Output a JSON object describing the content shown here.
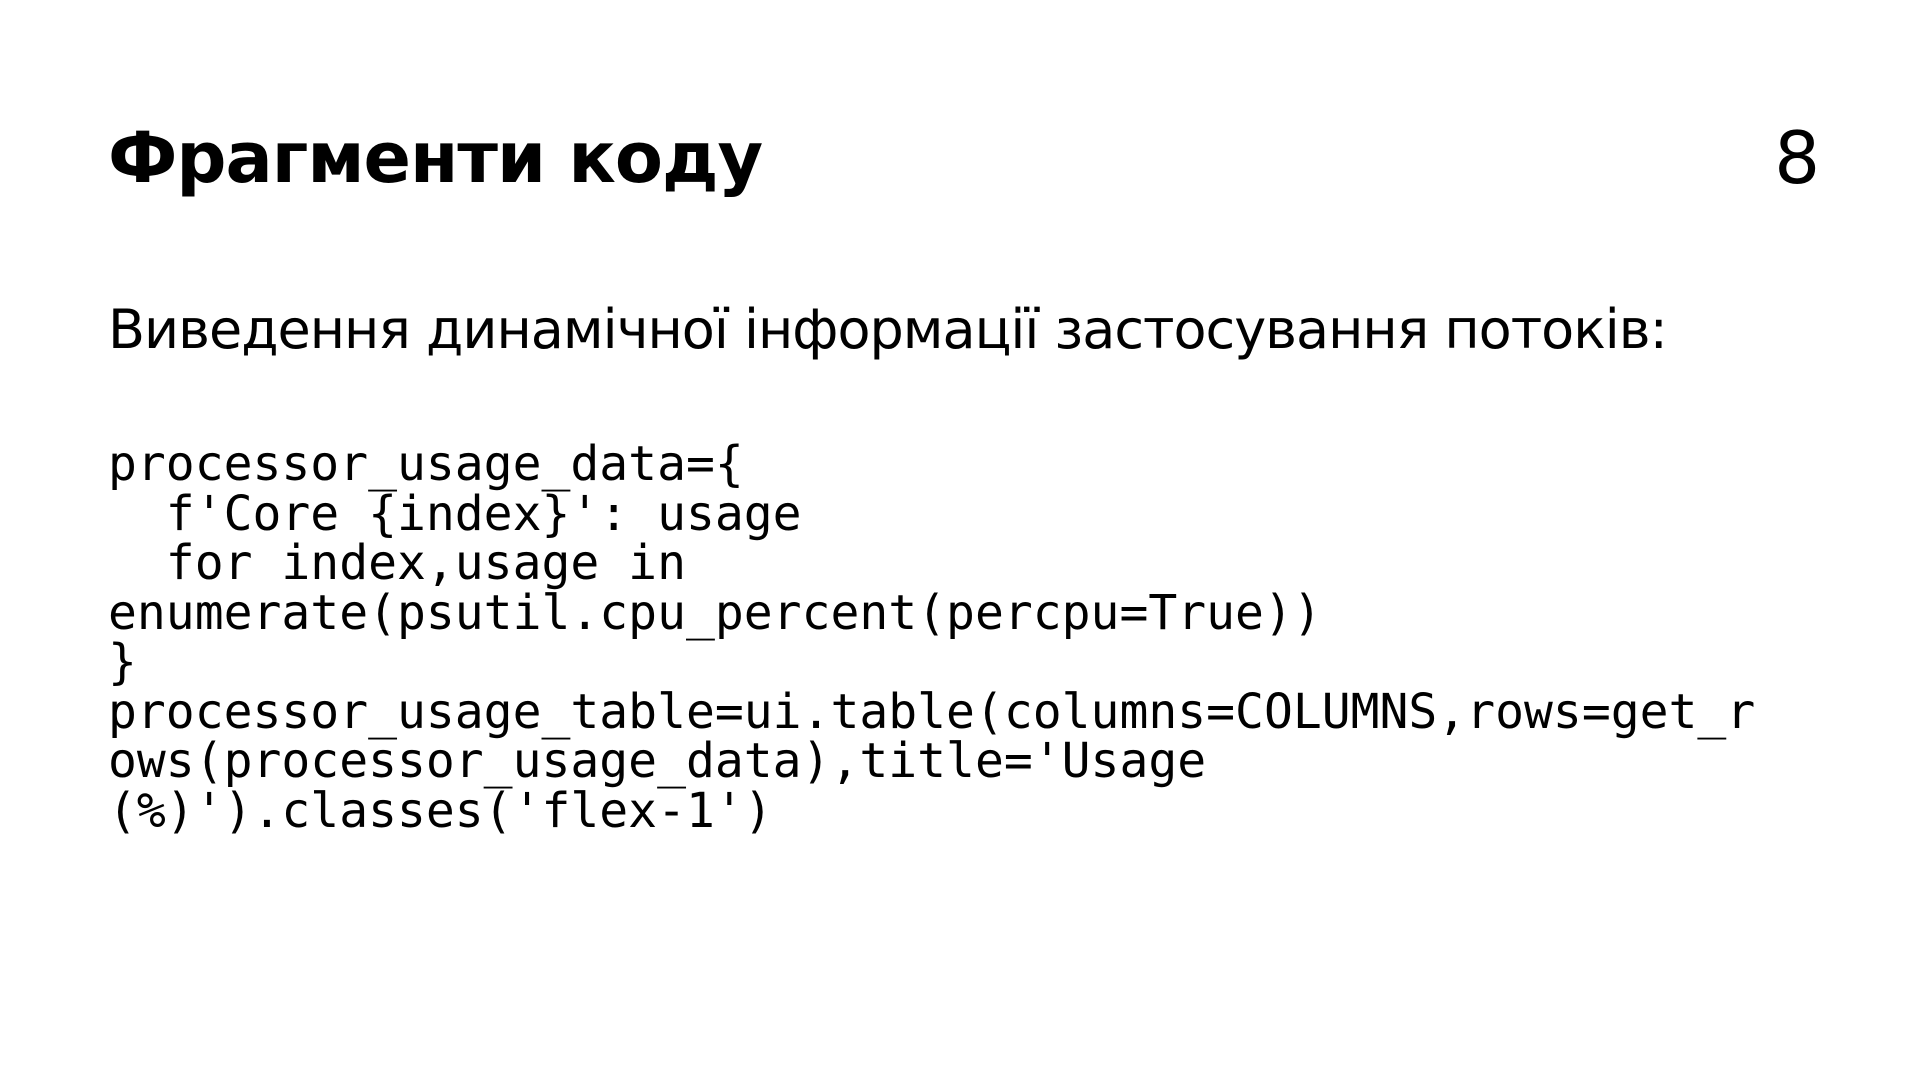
{
  "slide": {
    "title": "Фрагменти коду",
    "page_number": "8",
    "subtitle": "Виведення динамічної інформації застосування потоків:",
    "code_lines": [
      "processor_usage_data={",
      "  f'Core {index}': usage",
      "  for index,usage in",
      "enumerate(psutil.cpu_percent(percpu=True))",
      "}",
      "processor_usage_table=ui.table(columns=COLUMNS,rows=get_r",
      "ows(processor_usage_data),title='Usage",
      "(%)').classes('flex-1')"
    ]
  }
}
